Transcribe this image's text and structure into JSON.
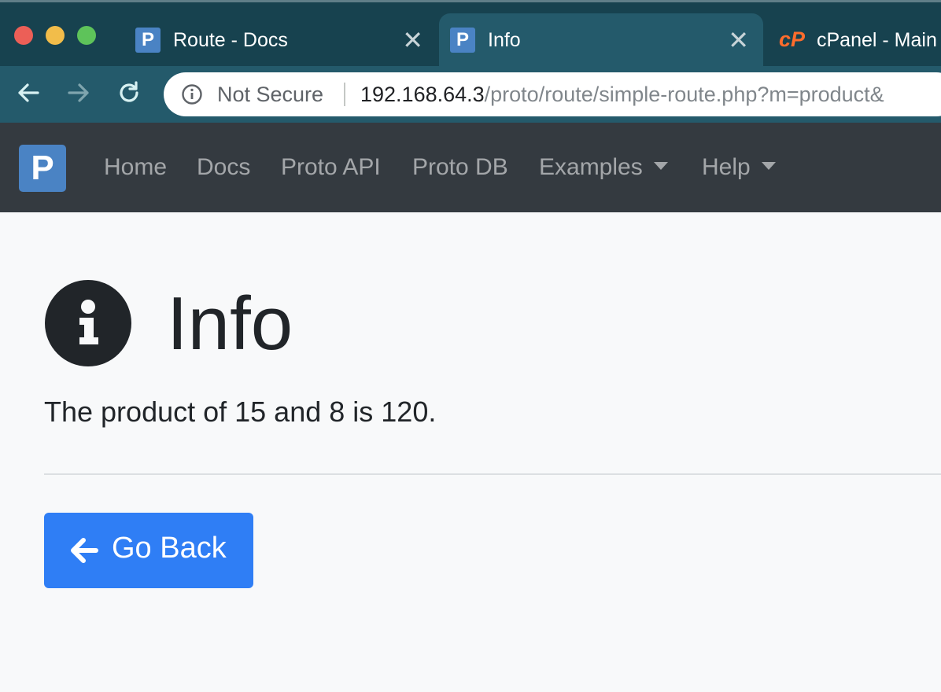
{
  "browser": {
    "tabs": [
      {
        "favicon": "P",
        "title": "Route - Docs",
        "active": false,
        "close": "✕"
      },
      {
        "favicon": "P",
        "title": "Info",
        "active": true,
        "close": "✕"
      },
      {
        "favicon": "cP",
        "title": "cPanel - Main",
        "active": false
      }
    ],
    "address": {
      "security_label": "Not Secure",
      "host": "192.168.64.3",
      "path": "/proto/route/simple-route.php?m=product&"
    }
  },
  "navbar": {
    "brand": "P",
    "items": [
      {
        "label": "Home"
      },
      {
        "label": "Docs"
      },
      {
        "label": "Proto API"
      },
      {
        "label": "Proto DB"
      },
      {
        "label": "Examples",
        "dropdown": true
      },
      {
        "label": "Help",
        "dropdown": true
      }
    ]
  },
  "page": {
    "icon": "info-circle-icon",
    "title": "Info",
    "message": "The product of 15 and 8 is 120.",
    "back_button": {
      "label": "Go Back",
      "icon": "arrow-left-icon"
    }
  },
  "colors": {
    "tabstrip": "#17424f",
    "toolbar": "#245a6b",
    "navbar": "#343a40",
    "primary": "#2f7ef5",
    "brand": "#4a83c4"
  }
}
